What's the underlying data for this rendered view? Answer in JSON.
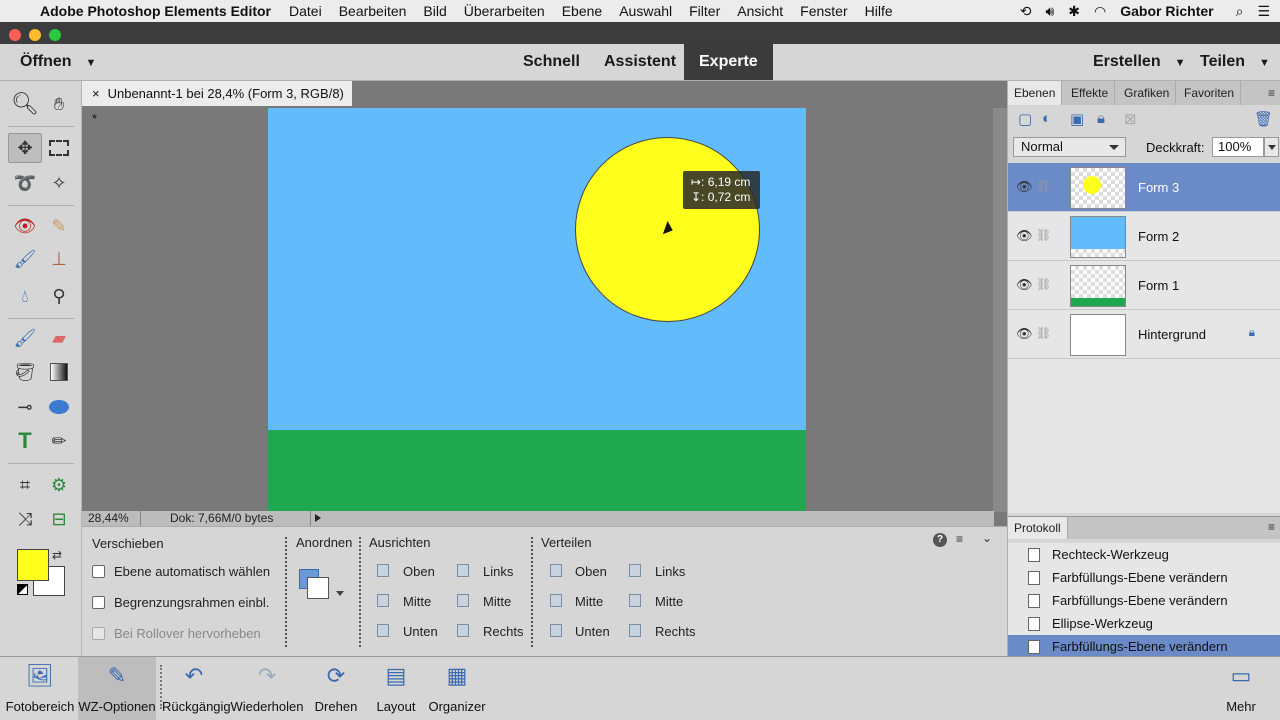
{
  "menubar": {
    "app_name": "Adobe Photoshop Elements Editor",
    "items": [
      "Datei",
      "Bearbeiten",
      "Bild",
      "Überarbeiten",
      "Ebene",
      "Auswahl",
      "Filter",
      "Ansicht",
      "Fenster",
      "Hilfe"
    ],
    "user": "Gabor Richter"
  },
  "modebar": {
    "open_label": "Öffnen",
    "modes": [
      "Schnell",
      "Assistent",
      "Experte"
    ],
    "active_mode": "Experte",
    "create_label": "Erstellen",
    "share_label": "Teilen"
  },
  "document": {
    "tab_title": "Unbenannt-1 bei 28,4% (Form 3, RGB/8) *",
    "measure": {
      "width": "↦: 6,19 cm",
      "height": "↧: 0,72 cm"
    },
    "colors": {
      "sky": "#62bbfa",
      "ground": "#1fa84f",
      "sun": "#fffe1d"
    }
  },
  "status": {
    "zoom": "28,44%",
    "doc_info": "Dok: 7,66M/0 bytes"
  },
  "options": {
    "tool_name": "Verschieben",
    "checkbox_auto_select": "Ebene automatisch wählen",
    "checkbox_bounding_box": "Begrenzungsrahmen einbl.",
    "checkbox_rollover": "Bei Rollover hervorheben",
    "arrange_label": "Anordnen",
    "align_label": "Ausrichten",
    "align_items": [
      "Oben",
      "Mitte",
      "Unten",
      "Links",
      "Mitte",
      "Rechts"
    ],
    "distribute_label": "Verteilen",
    "distribute_items": [
      "Oben",
      "Mitte",
      "Unten",
      "Links",
      "Mitte",
      "Rechts"
    ]
  },
  "layers_panel": {
    "tabs": [
      "Ebenen",
      "Effekte",
      "Grafiken",
      "Favoriten"
    ],
    "active_tab": "Ebenen",
    "blend_mode": "Normal",
    "opacity_label": "Deckkraft:",
    "opacity_value": "100%",
    "layers": [
      {
        "name": "Form 3",
        "selected": true
      },
      {
        "name": "Form 2",
        "selected": false
      },
      {
        "name": "Form 1",
        "selected": false
      },
      {
        "name": "Hintergrund",
        "selected": false
      }
    ]
  },
  "history_panel": {
    "title": "Protokoll",
    "items": [
      "Rechteck-Werkzeug",
      "Farbfüllungs-Ebene verändern",
      "Farbfüllungs-Ebene verändern",
      "Ellipse-Werkzeug",
      "Farbfüllungs-Ebene verändern"
    ],
    "selected_index": 4
  },
  "bottombar": {
    "buttons": [
      "Fotobereich",
      "WZ-Optionen",
      "Rückgängig",
      "Wiederholen",
      "Drehen",
      "Layout",
      "Organizer"
    ],
    "more_label": "Mehr"
  },
  "colors": {
    "foreground": "#fffe1d",
    "background": "#ffffff",
    "selection": "#6a8ac8"
  }
}
